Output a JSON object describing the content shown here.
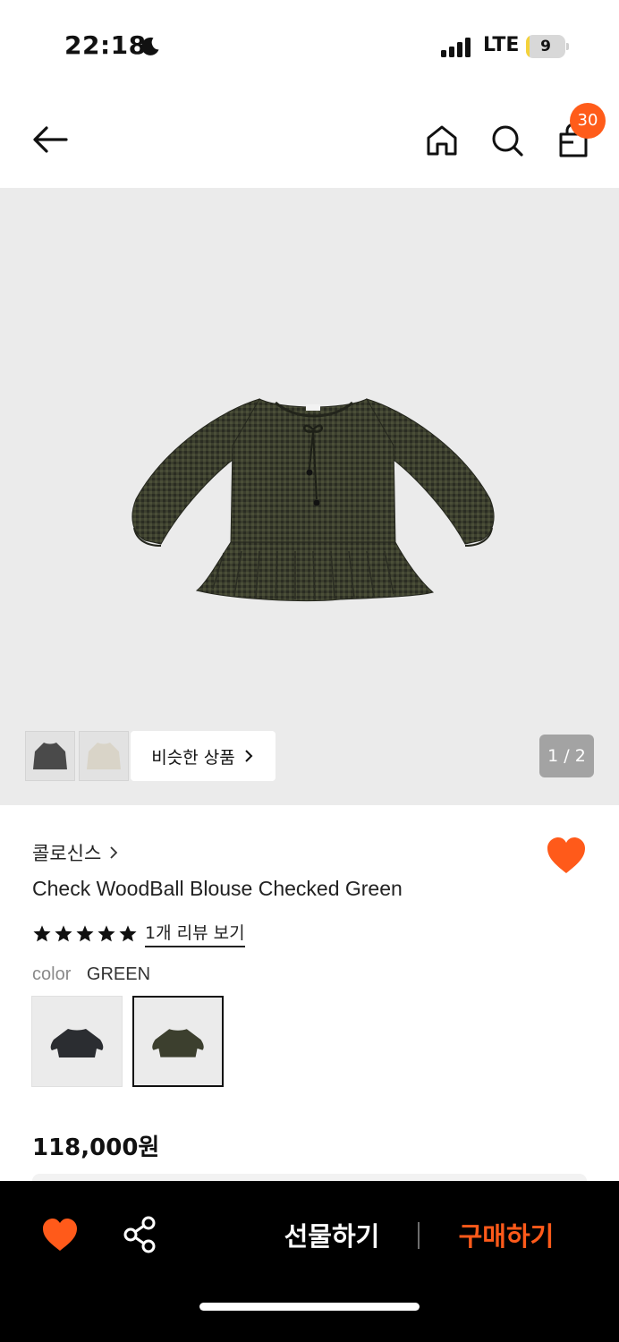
{
  "status_bar": {
    "time": "22:18",
    "network": "LTE",
    "battery": "9",
    "battery_level": 0.09,
    "icons": [
      "moon-icon",
      "signal-icon",
      "battery-icon"
    ]
  },
  "header": {
    "icons": [
      "back-arrow-icon",
      "home-icon",
      "search-icon",
      "shopping-bag-icon"
    ],
    "cart_count": "30"
  },
  "gallery": {
    "similar_products_label": "비슷한 상품",
    "page_indicator": "1 / 2"
  },
  "product": {
    "brand": "콜로신스",
    "name": "Check WoodBall Blouse Checked Green",
    "rating_stars": 5,
    "review_link": "1개 리뷰 보기",
    "option_label": "color",
    "option_value": "GREEN",
    "price": "118,000원"
  },
  "bottom_bar": {
    "gift_label": "선물하기",
    "buy_label": "구매하기",
    "icons": [
      "heart-icon",
      "share-icon"
    ]
  },
  "colors": {
    "accent": "#ff5a1a",
    "badge": "#ff5c1a",
    "blouse_green": "#3c3f2e",
    "blouse_black": "#2b2d31"
  }
}
